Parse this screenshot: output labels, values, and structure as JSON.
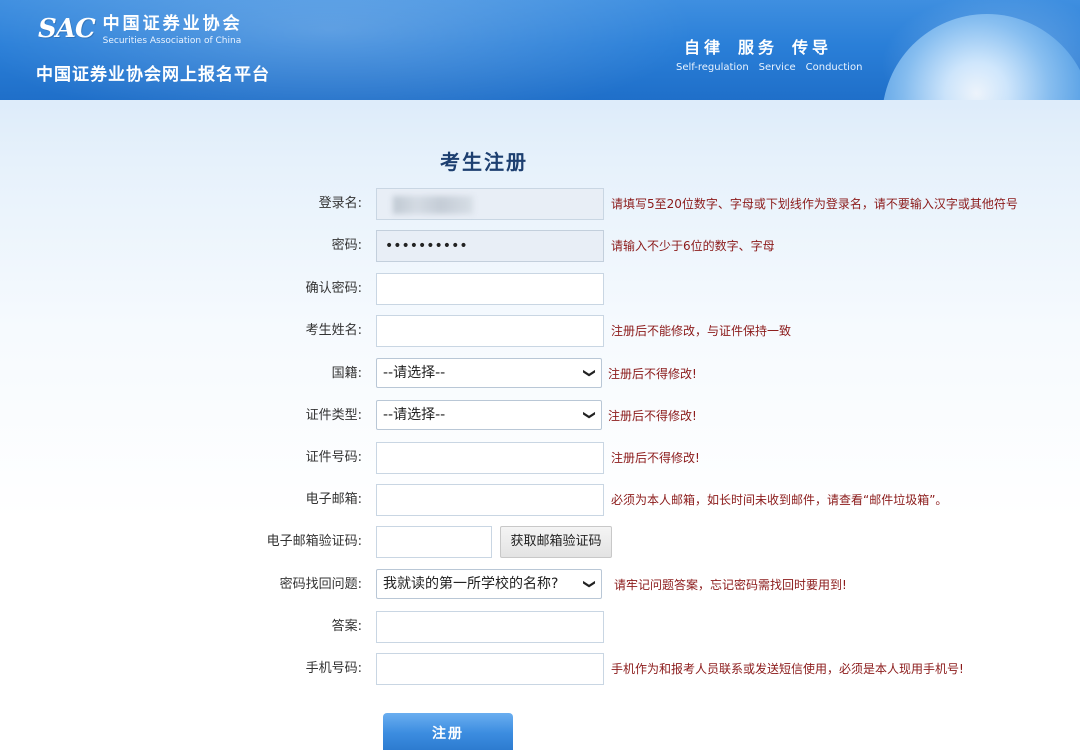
{
  "header": {
    "logo_mark": "SAC",
    "logo_cn": "中国证券业协会",
    "logo_en": "Securities Association of China",
    "site_title": "中国证券业协会网上报名平台",
    "motto": [
      {
        "cn": "自律",
        "en": "Self-regulation"
      },
      {
        "cn": "服务",
        "en": "Service"
      },
      {
        "cn": "传导",
        "en": "Conduction"
      }
    ]
  },
  "form": {
    "title": "考生注册",
    "fields": {
      "username": {
        "label": "登录名:",
        "value": "",
        "hint": "请填写5至20位数字、字母或下划线作为登录名，请不要输入汉字或其他符号"
      },
      "password": {
        "label": "密码:",
        "value": "••••••••••",
        "hint": "请输入不少于6位的数字、字母"
      },
      "confirm_password": {
        "label": "确认密码:",
        "value": "",
        "hint": ""
      },
      "name": {
        "label": "考生姓名:",
        "value": "",
        "hint": "注册后不能修改，与证件保持一致"
      },
      "nationality": {
        "label": "国籍:",
        "selected": "--请选择--",
        "hint": "注册后不得修改!"
      },
      "id_type": {
        "label": "证件类型:",
        "selected": "--请选择--",
        "hint": "注册后不得修改!"
      },
      "id_number": {
        "label": "证件号码:",
        "value": "",
        "hint": "注册后不得修改!"
      },
      "email": {
        "label": "电子邮箱:",
        "value": "",
        "hint": "必须为本人邮箱，如长时间未收到邮件，请查看“邮件垃圾箱”。"
      },
      "email_code": {
        "label": "电子邮箱验证码:",
        "value": "",
        "button": "获取邮箱验证码"
      },
      "security_question": {
        "label": "密码找回问题:",
        "selected": "我就读的第一所学校的名称?",
        "hint": "请牢记问题答案，忘记密码需找回时要用到!"
      },
      "answer": {
        "label": "答案:",
        "value": ""
      },
      "phone": {
        "label": "手机号码:",
        "value": "",
        "hint": "手机作为和报考人员联系或发送短信使用，必须是本人现用手机号!"
      }
    },
    "submit_label": "注册"
  },
  "colors": {
    "header_blue": "#2a7fd8",
    "hint_red": "#8b1a1a",
    "title_navy": "#1d3f70"
  }
}
